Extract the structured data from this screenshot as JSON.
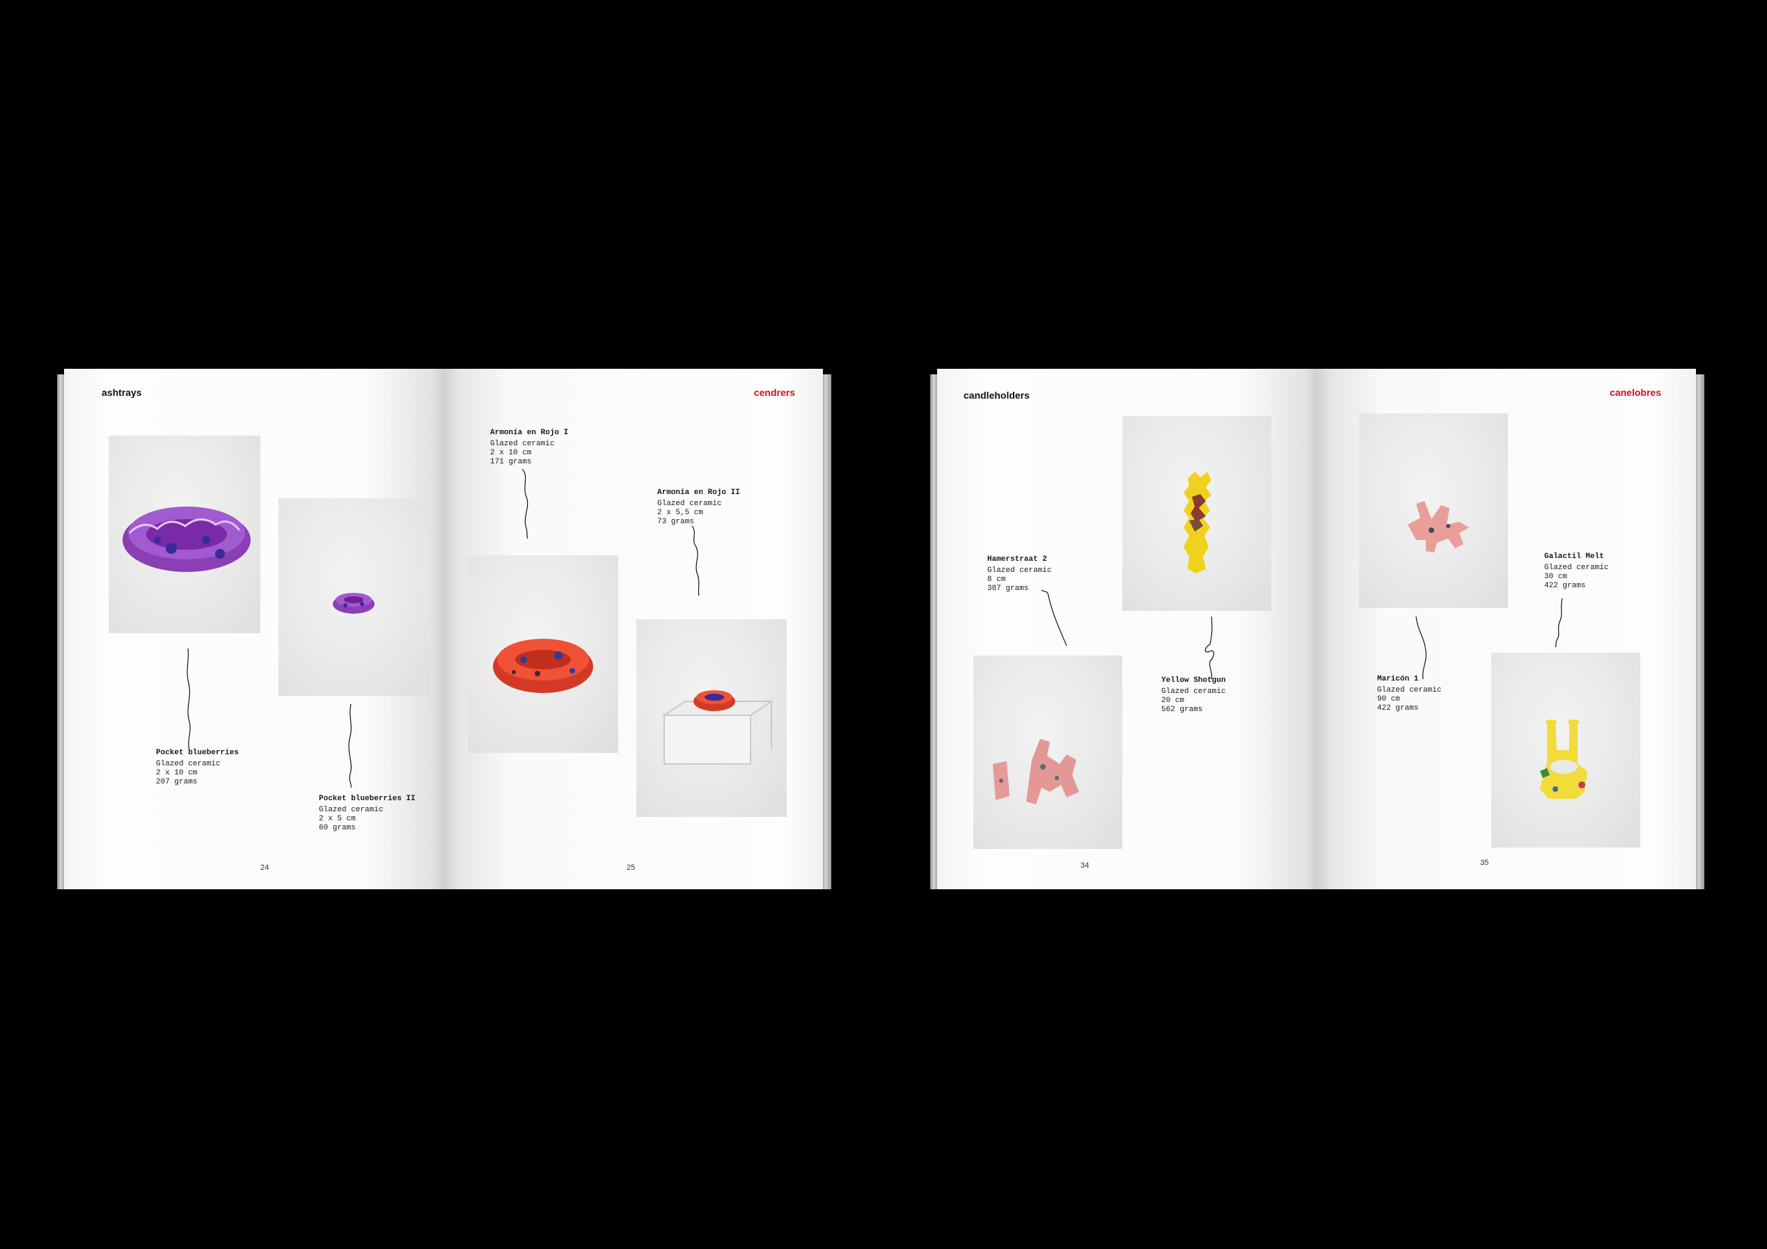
{
  "spread_ashtrays": {
    "left_header": "ashtrays",
    "right_header": "cendrers",
    "left_page_number": "24",
    "right_page_number": "25",
    "items": [
      {
        "title": "Pocket blueberries",
        "lines": [
          "Glazed ceramic",
          "2 x 10 cm",
          "207 grams"
        ]
      },
      {
        "title": "Pocket blueberries II",
        "lines": [
          "Glazed ceramic",
          "2 x 5 cm",
          "60 grams"
        ]
      },
      {
        "title": "Armonía en Rojo I",
        "lines": [
          "Glazed ceramic",
          "2 x 10 cm",
          "171 grams"
        ]
      },
      {
        "title": "Armonía en Rojo II",
        "lines": [
          "Glazed ceramic",
          "2 x 5,5 cm",
          "73 grams"
        ]
      }
    ]
  },
  "spread_candleholders": {
    "left_header": "candleholders",
    "right_header": "canelobres",
    "left_page_number": "34",
    "right_page_number": "35",
    "items": [
      {
        "title": "Hamerstraat 2",
        "lines": [
          "Glazed ceramic",
          "8 cm",
          "387 grams"
        ]
      },
      {
        "title": "Yellow Shotgun",
        "lines": [
          "Glazed ceramic",
          "20 cm",
          "562 grams"
        ]
      },
      {
        "title": "Maricón 1",
        "lines": [
          "Glazed ceramic",
          "90 cm",
          "422 grams"
        ]
      },
      {
        "title": "Galactil Melt",
        "lines": [
          "Glazed ceramic",
          "30 cm",
          "422 grams"
        ]
      }
    ]
  },
  "colors": {
    "background": "#000000",
    "accent_red": "#d0101f",
    "page": "#fbfbfb"
  },
  "icons": [
    "ashtray-photo",
    "candleholder-photo",
    "pen-squiggle"
  ]
}
